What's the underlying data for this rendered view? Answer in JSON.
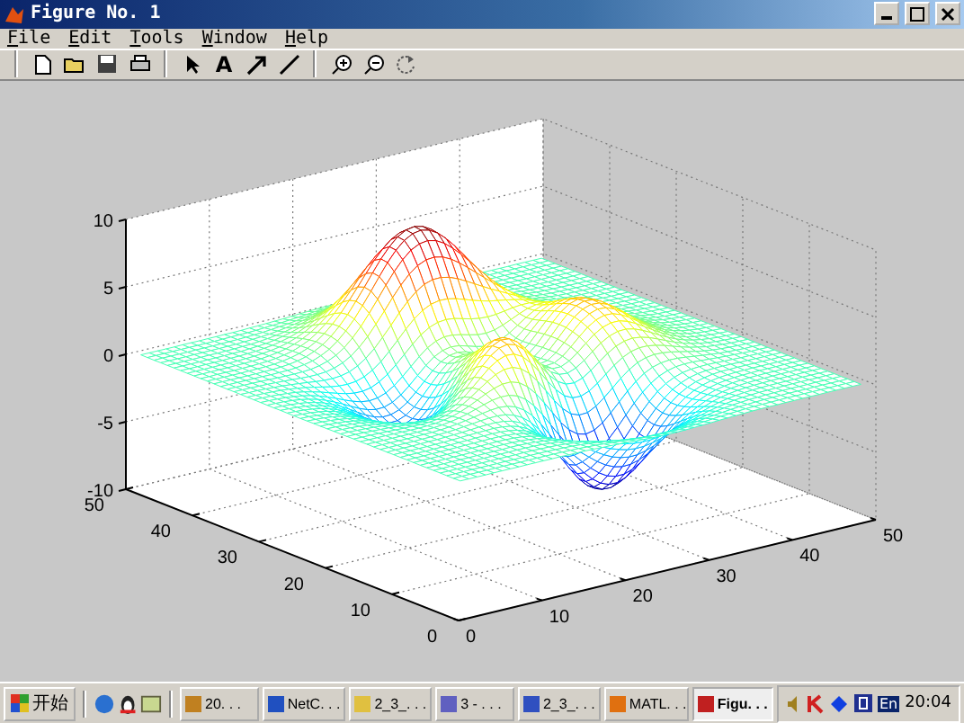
{
  "window": {
    "title": "Figure No. 1"
  },
  "menu": [
    {
      "label": "File"
    },
    {
      "label": "Edit"
    },
    {
      "label": "Tools"
    },
    {
      "label": "Window"
    },
    {
      "label": "Help"
    }
  ],
  "toolbar": {
    "text_tool_label": "A"
  },
  "plot": {
    "z_ticks": [
      "10",
      "5",
      "0",
      "-5",
      "-10"
    ],
    "x_ticks": [
      "0",
      "10",
      "20",
      "30",
      "40",
      "50"
    ],
    "y_ticks": [
      "0",
      "10",
      "20",
      "30",
      "40",
      "50"
    ]
  },
  "taskbar": {
    "start_label": "开始",
    "tasks": [
      {
        "label": "20. . .",
        "selected": false
      },
      {
        "label": "NetC. . .",
        "selected": false
      },
      {
        "label": "2_3_. . .",
        "selected": false
      },
      {
        "label": "3 - . . .",
        "selected": false
      },
      {
        "label": "2_3_. . .",
        "selected": false
      },
      {
        "label": "MATL. . .",
        "selected": false
      },
      {
        "label": "Figu. . .",
        "selected": true
      }
    ],
    "language": "En",
    "clock": "20:04"
  }
}
